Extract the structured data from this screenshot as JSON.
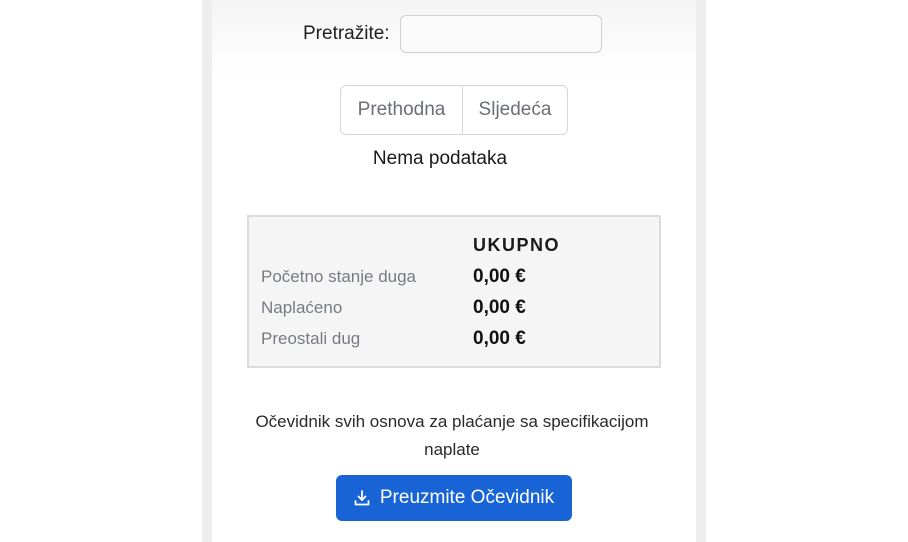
{
  "search": {
    "label": "Pretražite:",
    "value": "",
    "placeholder": ""
  },
  "pagination": {
    "prev_label": "Prethodna",
    "next_label": "Sljedeća"
  },
  "table": {
    "empty_message": "Nema podataka"
  },
  "summary": {
    "header": "UKUPNO",
    "rows": [
      {
        "label": "Početno stanje duga",
        "value": "0,00 €"
      },
      {
        "label": "Naplaćeno",
        "value": "0,00 €"
      },
      {
        "label": "Preostali dug",
        "value": "0,00 €"
      }
    ]
  },
  "download": {
    "description": "Očevidnik svih osnova za plaćanje sa specifikacijom naplate",
    "button_label": "Preuzmite Očevidnik",
    "icon": "download-icon"
  },
  "colors": {
    "primary": "#1864d6",
    "summary_bg": "#f5f5f5",
    "muted_text": "#777b80"
  }
}
